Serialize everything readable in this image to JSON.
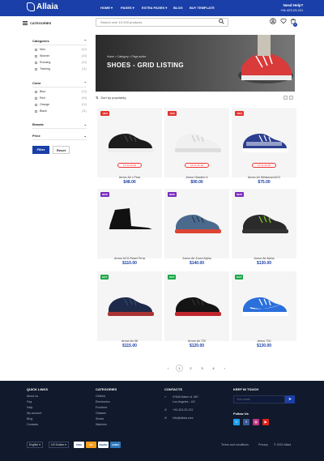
{
  "brand": "Allaia",
  "nav": [
    {
      "label": "HOME",
      "dropdown": true
    },
    {
      "label": "PAGES",
      "dropdown": true
    },
    {
      "label": "EXTRA PAGES",
      "dropdown": true
    },
    {
      "label": "BLOG",
      "dropdown": false
    },
    {
      "label": "BUY TEMPLATE",
      "dropdown": false
    }
  ],
  "help": {
    "label": "Need Help?",
    "phone": "+94 423-23-221"
  },
  "header": {
    "categories_label": "CATEGORIES",
    "search_placeholder": "Search over 10.000 products"
  },
  "cart_count": "0",
  "sidebar": {
    "categories": {
      "title": "Categories",
      "items": [
        {
          "label": "Men",
          "count": "(12)"
        },
        {
          "label": "Women",
          "count": "(24)"
        },
        {
          "label": "Running",
          "count": "(23)"
        },
        {
          "label": "Training",
          "count": "(11)"
        }
      ]
    },
    "color": {
      "title": "Color",
      "items": [
        {
          "label": "Blue",
          "count": "(12)"
        },
        {
          "label": "Red",
          "count": "(24)"
        },
        {
          "label": "Orange",
          "count": "(10)"
        },
        {
          "label": "Black",
          "count": "(11)"
        }
      ]
    },
    "brands_title": "Brands",
    "price_title": "Price",
    "filter_label": "Filter",
    "reset_label": "Reset"
  },
  "hero": {
    "breadcrumb": "Home > Category > Page active",
    "title": "SHOES - GRID LISTING"
  },
  "sort_label": "Sort by popularity",
  "products": [
    {
      "name": "Armor Air x Fear",
      "price": "$48.00",
      "tag": "-30%",
      "tag_color": "#e3342f",
      "countdown": "1D 11:26:36"
    },
    {
      "name": "Armor Okwahn II",
      "price": "$90.00",
      "tag": "-50%",
      "tag_color": "#e3342f",
      "countdown": "1D 11:26:36"
    },
    {
      "name": "Armor Air Wildwood ACG",
      "price": "$75.00",
      "tag": "-60%",
      "tag_color": "#e3342f",
      "countdown": "1D 11:26:36"
    },
    {
      "name": "Armor ACG React Terra",
      "price": "$110.00",
      "tag": "NEW",
      "tag_color": "#7a2bbf",
      "countdown": ""
    },
    {
      "name": "Armor Air Zoom Alpha",
      "price": "$140.00",
      "tag": "NEW",
      "tag_color": "#7a2bbf",
      "countdown": ""
    },
    {
      "name": "Armor Air Alpha",
      "price": "$130.00",
      "tag": "NEW",
      "tag_color": "#7a2bbf",
      "countdown": ""
    },
    {
      "name": "Armor Air 98",
      "price": "$115.00",
      "tag": "HOT",
      "tag_color": "#1ea84a",
      "countdown": ""
    },
    {
      "name": "Armor Air 720",
      "price": "$120.00",
      "tag": "HOT",
      "tag_color": "#1ea84a",
      "countdown": ""
    },
    {
      "name": "Armor 720",
      "price": "$130.00",
      "tag": "HOT",
      "tag_color": "#1ea84a",
      "countdown": ""
    }
  ],
  "pagination": [
    "‹",
    "1",
    "2",
    "3",
    "4",
    "›"
  ],
  "footer": {
    "quick_links": {
      "title": "QUICK LINKS",
      "items": [
        "About us",
        "Faq",
        "Help",
        "My account",
        "Blog",
        "Contacts"
      ]
    },
    "categories": {
      "title": "CATEGORIES",
      "items": [
        "Clothes",
        "Electronics",
        "Furniture",
        "Glasses",
        "Shoes",
        "Watches"
      ]
    },
    "contacts": {
      "title": "CONTACTS",
      "address1": "97845 Baker st. 567",
      "address2": "Los Angeles - US",
      "phone": "+94 423-23-221",
      "email": "info@allaia.com"
    },
    "keep_in_touch": {
      "title": "KEEP IN TOUCH",
      "placeholder": "Your email",
      "follow_title": "Follow Us"
    },
    "language": "English",
    "currency": "US Dollars",
    "payments": [
      "VISA",
      "MC",
      "PayPal",
      "AMEX"
    ],
    "bottom_links": [
      "Terms and conditions",
      "Privacy",
      "© 2020 Allaia"
    ]
  }
}
